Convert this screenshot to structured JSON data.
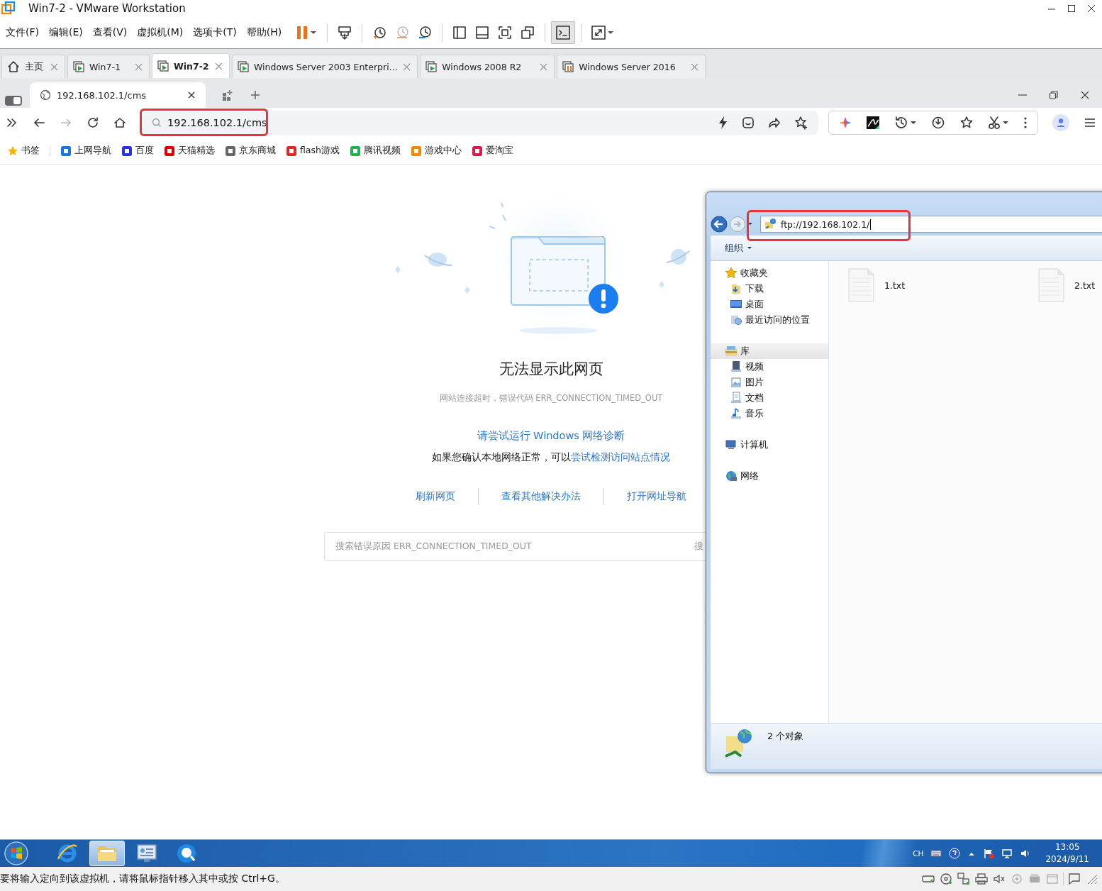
{
  "window": {
    "title": "Win7-2 - VMware Workstation"
  },
  "menu": [
    "文件(F)",
    "编辑(E)",
    "查看(V)",
    "虚拟机(M)",
    "选项卡(T)",
    "帮助(H)"
  ],
  "vm_tabs": [
    {
      "label": "主页",
      "kind": "home",
      "selected": false
    },
    {
      "label": "Win7-1",
      "kind": "vm",
      "selected": false
    },
    {
      "label": "Win7-2",
      "kind": "vm",
      "selected": true
    },
    {
      "label": "Windows Server 2003 Enterpri…",
      "kind": "vm",
      "selected": false
    },
    {
      "label": "Windows 2008 R2",
      "kind": "vm",
      "selected": false
    },
    {
      "label": "Windows Server 2016",
      "kind": "paused",
      "selected": false
    }
  ],
  "browser": {
    "tab_title": "192.168.102.1/cms",
    "address": "192.168.102.1/cms",
    "bookmarks": [
      {
        "label": "书签",
        "color": "#f5b400"
      },
      {
        "label": "上网导航",
        "color": "#1a73e8"
      },
      {
        "label": "百度",
        "color": "#2932e1"
      },
      {
        "label": "天猫精选",
        "color": "#e00000"
      },
      {
        "label": "京东商城",
        "color": "#666666"
      },
      {
        "label": "flash游戏",
        "color": "#e02828"
      },
      {
        "label": "腾讯视频",
        "color": "#22b14c"
      },
      {
        "label": "游戏中心",
        "color": "#f08a00"
      },
      {
        "label": "爱淘宝",
        "color": "#d81e48"
      }
    ]
  },
  "error_page": {
    "title": "无法显示此网页",
    "detail": "网站连接超时，错误代码 ERR_CONNECTION_TIMED_OUT",
    "diagnose_link": "请尝试运行 Windows 网络诊断",
    "hint": "如果您确认本地网络正常，可以",
    "hint_link": "尝试检测访问站点情况",
    "actions": [
      "刷新网页",
      "查看其他解决办法",
      "打开网址导航"
    ],
    "search": {
      "placeholder": "搜索错误原因 ERR_CONNECTION_TIMED_OUT",
      "button": "搜"
    }
  },
  "explorer": {
    "address": "ftp://192.168.102.1/",
    "organize": "组织",
    "nav": [
      {
        "label": "收藏夹",
        "kind": "favorites",
        "selected": false,
        "children": [
          {
            "label": "下载",
            "kind": "downloads",
            "selected": false
          },
          {
            "label": "桌面",
            "kind": "desktop",
            "selected": false
          },
          {
            "label": "最近访问的位置",
            "kind": "recent",
            "selected": false
          }
        ]
      },
      {
        "label": "库",
        "kind": "libraries",
        "selected": true,
        "children": [
          {
            "label": "视频",
            "kind": "videos",
            "selected": false
          },
          {
            "label": "图片",
            "kind": "pictures",
            "selected": false
          },
          {
            "label": "文档",
            "kind": "documents",
            "selected": false
          },
          {
            "label": "音乐",
            "kind": "music",
            "selected": false
          }
        ]
      },
      {
        "label": "计算机",
        "kind": "computer",
        "selected": false
      },
      {
        "label": "网络",
        "kind": "network",
        "selected": false
      }
    ],
    "files": [
      "1.txt",
      "2.txt"
    ],
    "status": "2 个对象"
  },
  "taskbar": {
    "items": [
      {
        "kind": "ie",
        "selected": false
      },
      {
        "kind": "folder",
        "selected": true
      },
      {
        "kind": "control",
        "selected": false
      },
      {
        "kind": "browser",
        "selected": false
      }
    ],
    "language": "CH",
    "time": "13:05",
    "date": "2024/9/11"
  },
  "status_bar": {
    "message": "要将输入定向到该虚拟机，请将鼠标指针移入其中或按 Ctrl+G。"
  }
}
